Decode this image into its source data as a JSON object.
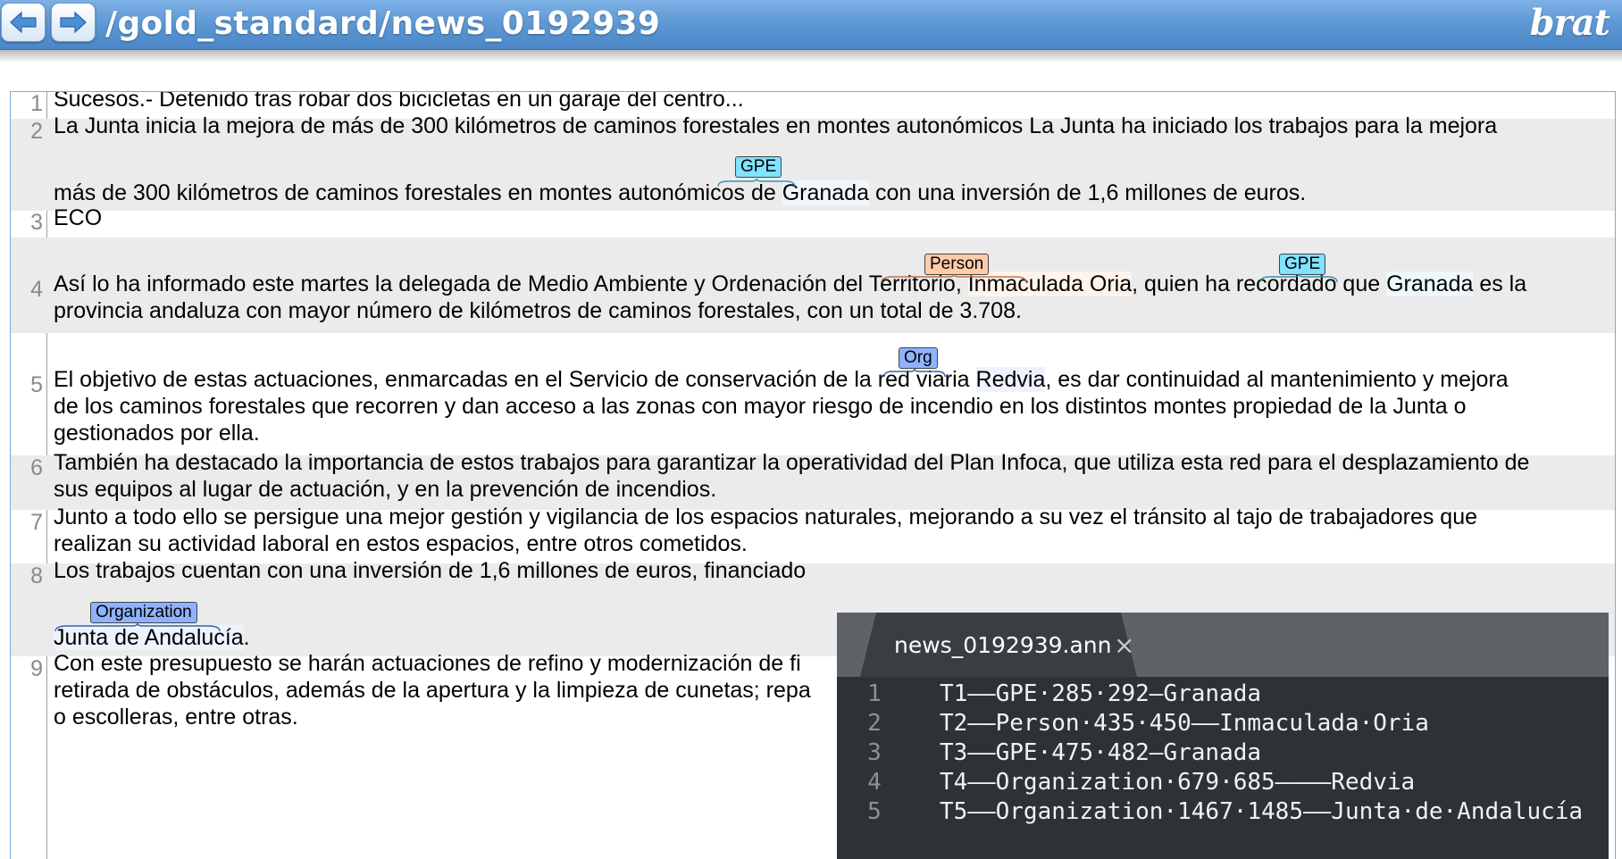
{
  "header": {
    "path": "/gold_standard/news_0192939",
    "brand": "brat",
    "back_icon": "arrow-left-icon",
    "forward_icon": "arrow-right-icon"
  },
  "colors": {
    "gpe": "#7fe2ff",
    "person": "#ffccaa",
    "organization": "#8fb2ff",
    "header": "#5f99d6"
  },
  "document": {
    "sentences": [
      {
        "num": "1",
        "lines": [
          "Sucesos.- Detenido tras robar dos bicicletas en un garaje del centro..."
        ]
      },
      {
        "num": "2",
        "lines": [
          "La Junta inicia la mejora de más de 300 kilómetros de caminos forestales en montes autonómicos La Junta ha iniciado los trabajos para la mejora",
          [
            "más de 300 kilómetros de caminos forestales en montes autonómicos de ",
            "Granada",
            " con una inversión de 1,6 millones de euros."
          ]
        ]
      },
      {
        "num": "3",
        "lines": [
          "ECO"
        ]
      },
      {
        "num": "4",
        "lines": [
          [
            "Así lo ha informado este martes la delegada de Medio Ambiente y Ordenación del Territorio, ",
            "Inmaculada Oria",
            ", quien ha recordado que ",
            "Granada",
            " es la"
          ],
          "provincia andaluza con mayor número de kilómetros de caminos forestales, con un total de 3.708."
        ]
      },
      {
        "num": "5",
        "lines": [
          [
            "El objetivo de estas actuaciones, enmarcadas en el Servicio de conservación de la red viaria ",
            "Redvia",
            ", es dar continuidad al mantenimiento y mejora"
          ],
          "de los caminos forestales que recorren y dan acceso a las zonas con mayor riesgo de incendio en los distintos montes propiedad de la Junta o",
          "gestionados por ella."
        ]
      },
      {
        "num": "6",
        "lines": [
          "También ha destacado la importancia de estos trabajos para garantizar la operatividad del Plan Infoca, que utiliza esta red para el desplazamiento de",
          "sus equipos al lugar de actuación, y en la prevención de incendios."
        ]
      },
      {
        "num": "7",
        "lines": [
          "Junto a todo ello se persigue una mejor gestión y vigilancia de los espacios naturales, mejorando a su vez el tránsito al tajo de trabajadores que",
          "realizan su actividad laboral en estos espacios, entre otros cometidos."
        ]
      },
      {
        "num": "8",
        "lines": [
          "Los trabajos cuentan con una inversión de 1,6 millones de euros, financiado",
          [
            "Junta de Andalucía",
            "."
          ]
        ]
      },
      {
        "num": "9",
        "lines": [
          "Con este presupuesto se harán actuaciones de refino y modernización de fi",
          "retirada de obstáculos, además de la apertura y la limpieza de cunetas; repa",
          "o escolleras, entre otras."
        ]
      }
    ],
    "entity_labels": {
      "granada_1": "GPE",
      "inmaculada": "Person",
      "granada_2": "GPE",
      "redvia": "Org",
      "junta": "Organization"
    }
  },
  "ann_file": {
    "tab_title": "news_0192939.ann",
    "close_glyph": "×",
    "rows": [
      {
        "num": "1",
        "text": "T1——GPE·285·292—Granada"
      },
      {
        "num": "2",
        "text": "T2——Person·435·450——Inmaculada·Oria"
      },
      {
        "num": "3",
        "text": "T3——GPE·475·482—Granada"
      },
      {
        "num": "4",
        "text": "T4——Organization·679·685————Redvia"
      },
      {
        "num": "5",
        "text": "T5——Organization·1467·1485——Junta·de·Andalucía"
      }
    ]
  }
}
